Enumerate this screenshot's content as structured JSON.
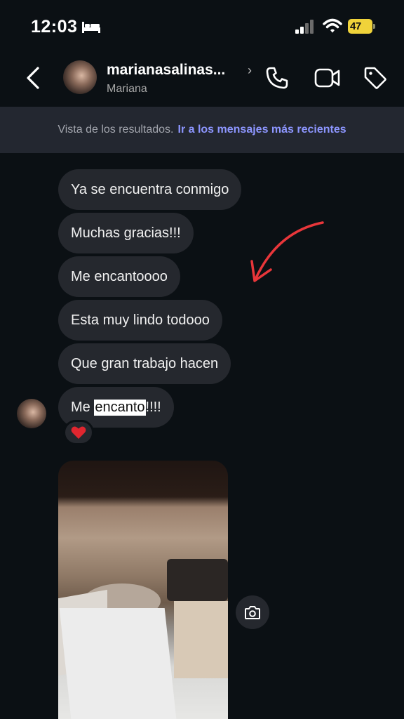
{
  "status_bar": {
    "time": "12:03",
    "battery": "47"
  },
  "header": {
    "username": "marianasalinas...",
    "subtitle": "Mariana"
  },
  "banner": {
    "text": "Vista de los resultados.",
    "link": "Ir a los mensajes más recientes"
  },
  "messages": [
    {
      "text": "Ya se encuentra conmigo"
    },
    {
      "text": "Muchas gracias!!!"
    },
    {
      "text": "Me encantoooo"
    },
    {
      "text": "Esta muy lindo todooo"
    },
    {
      "text": "Que gran trabajo hacen"
    },
    {
      "prefix": "Me ",
      "highlight": "encanto",
      "suffix": "!!!!"
    }
  ],
  "reaction": {
    "emoji": "heart",
    "color": "#e0262f"
  },
  "colors": {
    "background": "#0b1014",
    "bubble": "#25282e",
    "link": "#8d96ff",
    "annotation_arrow": "#e8363a"
  },
  "icons": [
    "back-icon",
    "call-icon",
    "video-icon",
    "tag-icon",
    "camera-icon",
    "heart-icon",
    "wifi-icon",
    "signal-icon",
    "bed-icon"
  ]
}
